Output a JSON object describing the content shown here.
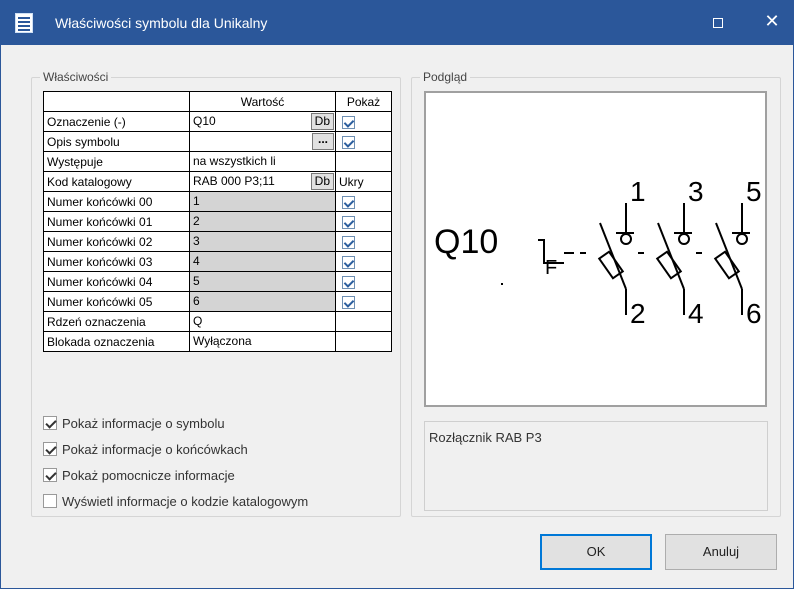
{
  "window": {
    "title": "Właściwości symbolu dla Unikalny",
    "maximize_glyph": "□",
    "close_glyph": "✕",
    "titlebar_color": "#2b579a"
  },
  "properties_group": {
    "label": "Właściwości",
    "headers": [
      "",
      "Wartość",
      "Pokaż"
    ],
    "rows": [
      {
        "name": "Oznaczenie (-)",
        "value": "Q10",
        "button": "Db",
        "show": "checked",
        "grey": false
      },
      {
        "name": "Opis symbolu",
        "value": "",
        "button": "...",
        "show": "checked",
        "grey": false
      },
      {
        "name": "Występuje",
        "value": "na wszystkich li",
        "button": "",
        "show": "",
        "grey": false
      },
      {
        "name": "Kod katalogowy",
        "value": "RAB 000 P3;11",
        "button": "Db",
        "show": "Ukry",
        "grey": false
      },
      {
        "name": "Numer końcówki 00",
        "value": "1",
        "button": "",
        "show": "checked",
        "grey": true
      },
      {
        "name": "Numer końcówki 01",
        "value": "2",
        "button": "",
        "show": "checked",
        "grey": true
      },
      {
        "name": "Numer końcówki 02",
        "value": "3",
        "button": "",
        "show": "checked",
        "grey": true
      },
      {
        "name": "Numer końcówki 03",
        "value": "4",
        "button": "",
        "show": "checked",
        "grey": true
      },
      {
        "name": "Numer końcówki 04",
        "value": "5",
        "button": "",
        "show": "checked",
        "grey": true
      },
      {
        "name": "Numer końcówki 05",
        "value": "6",
        "button": "",
        "show": "checked",
        "grey": true
      },
      {
        "name": "Rdzeń oznaczenia",
        "value": "Q",
        "button": "",
        "show": "",
        "grey": false
      },
      {
        "name": "Blokada oznaczenia",
        "value": "Wyłączona",
        "button": "",
        "show": "",
        "grey": false
      }
    ]
  },
  "options": [
    {
      "label": "Pokaż informacje o symbolu",
      "checked": true
    },
    {
      "label": "Pokaż informacje o końcówkach",
      "checked": true
    },
    {
      "label": "Pokaż pomocnicze informacje",
      "checked": true
    },
    {
      "label": "Wyświetl informacje o kodzie katalogowym",
      "checked": false
    }
  ],
  "preview_group": {
    "label": "Podgląd",
    "symbol": {
      "designation": "Q10",
      "terminal_top": [
        "1",
        "3",
        "5"
      ],
      "terminal_bottom": [
        "2",
        "4",
        "6"
      ],
      "function_letter": "F"
    },
    "description": "Rozłącznik RAB P3"
  },
  "buttons": {
    "ok": "OK",
    "cancel": "Anuluj"
  }
}
